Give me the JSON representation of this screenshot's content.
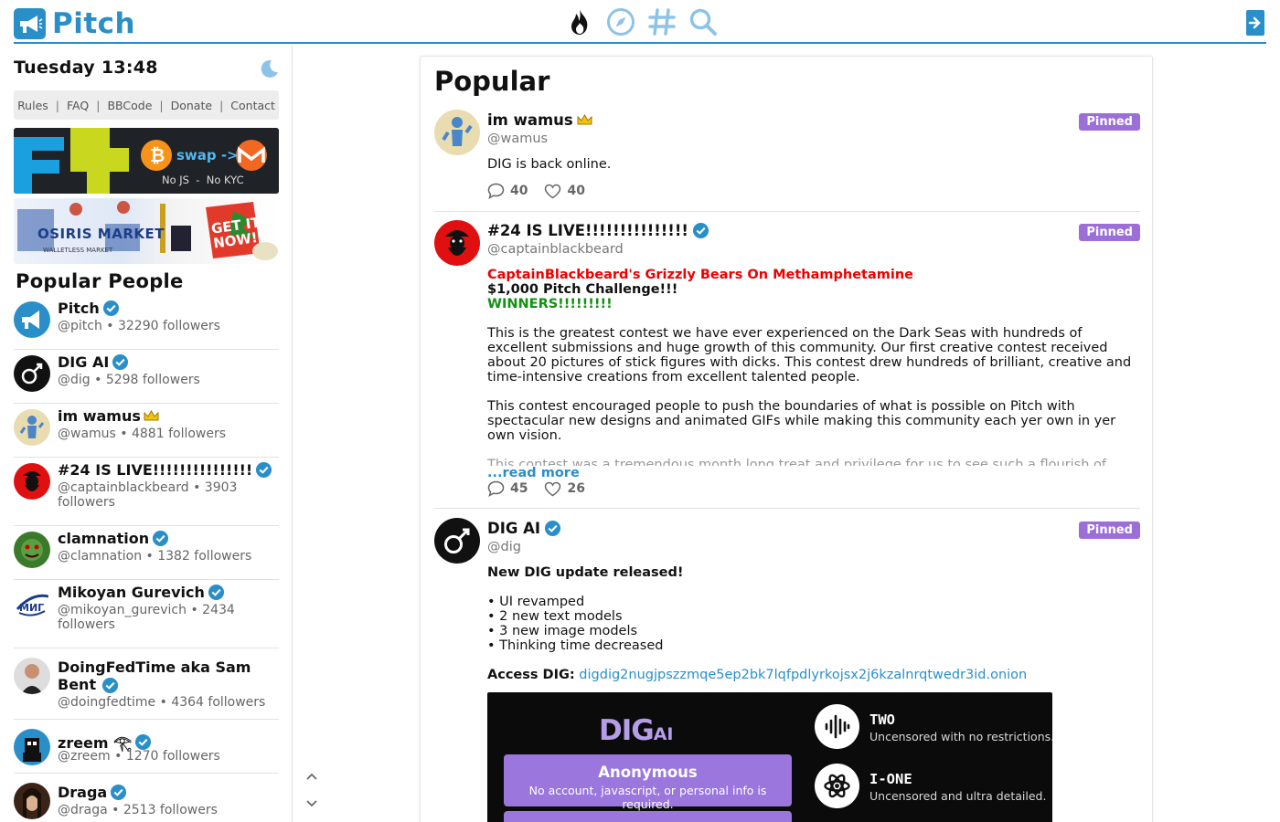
{
  "brand": {
    "name": "Pitch",
    "color": "#2a8fc8"
  },
  "nav": {
    "icons": [
      "fire-icon",
      "compass-icon",
      "hashtag-icon",
      "search-icon"
    ],
    "login_icon": "login-icon"
  },
  "sidebar": {
    "clock": "Tuesday 13:48",
    "links": [
      "Rules",
      "FAQ",
      "BBCode",
      "Donate",
      "Contact"
    ],
    "banner1": {
      "swap_text": "swap ->",
      "sub_text": "No JS  -  No KYC"
    },
    "banner2": {
      "title": "OSIRIS MARKET",
      "sub": "WALLETLESS MARKET",
      "cta": "GET IT NOW!"
    },
    "popular_title": "Popular People",
    "people": [
      {
        "name": "Pitch",
        "meta": "@pitch • 32290 followers",
        "badge": "verified"
      },
      {
        "name": "DIG AI",
        "meta": "@dig • 5298 followers",
        "badge": "verified"
      },
      {
        "name": "im wamus",
        "meta": "@wamus • 4881 followers",
        "badge": "crown"
      },
      {
        "name": "#24 IS LIVE!!!!!!!!!!!!!!!",
        "meta": "@captainblackbeard • 3903 followers",
        "badge": "verified"
      },
      {
        "name": "clamnation",
        "meta": "@clamnation • 1382 followers",
        "badge": "verified"
      },
      {
        "name": "Mikoyan Gurevich",
        "meta": "@mikoyan_gurevich • 2434 followers",
        "badge": "verified"
      },
      {
        "name": "DoingFedTime aka Sam Bent",
        "meta": "@doingfedtime • 4364 followers",
        "badge": "verified"
      },
      {
        "name": "zreem 𓂀",
        "meta": "@zreem • 1270 followers",
        "badge": "verified"
      },
      {
        "name": "Draga",
        "meta": "@draga • 2513 followers",
        "badge": "verified"
      }
    ]
  },
  "feed": {
    "title": "Popular",
    "pinned_label": "Pinned",
    "posts": [
      {
        "name": "im wamus",
        "handle": "@wamus",
        "body": "DIG is back online.",
        "comments": "40",
        "likes": "40"
      },
      {
        "name": "#24 IS LIVE!!!!!!!!!!!!!!!",
        "handle": "@captainblackbeard",
        "headline_red": "CaptainBlackbeard's Grizzly Bears On Methamphetamine",
        "headline_black": "$1,000 Pitch Challenge!!!",
        "headline_green": "WINNERS!!!!!!!!!",
        "para1": "This is the greatest contest we have ever experienced on the Dark Seas with hundreds of excellent submissions and huge growth of this community. Our first creative contest received about 20 pictures of stick figures with dicks. This contest drew hundreds of brilliant, creative and time-intensive creations from excellent talented people.",
        "para2": "This contest encouraged people to push the boundaries of what is possible on Pitch with spectacular new designs and animated GIFs while making this community each yer own in yer own vision.",
        "para3": "This contest was a tremendous month long treat and privilege for us to see such a flourish of",
        "read_more": "...read more",
        "comments": "45",
        "likes": "26"
      },
      {
        "name": "DIG AI",
        "handle": "@dig",
        "headline": "New DIG update released!",
        "bullets": [
          "• UI revamped",
          "• 2 new text models",
          "• 3 new image models",
          "• Thinking time decreased"
        ],
        "access_label": "Access DIG:",
        "access_link": "digdig2nugjpszzmqe5ep2bk7lqfpdlyrkojsx2j6kzalnrqtwedr3id.onion",
        "card": {
          "logo": "DIG",
          "logo_sub": "AI",
          "anon_title": "Anonymous",
          "anon_sub": "No account, javascript, or personal info is required.",
          "models": [
            {
              "title": "TWO",
              "sub": "Uncensored with no restrictions.",
              "icon": "waveform-icon"
            },
            {
              "title": "I-ONE",
              "sub": "Uncensored and ultra detailed.",
              "icon": "atom-icon"
            }
          ]
        }
      }
    ]
  }
}
